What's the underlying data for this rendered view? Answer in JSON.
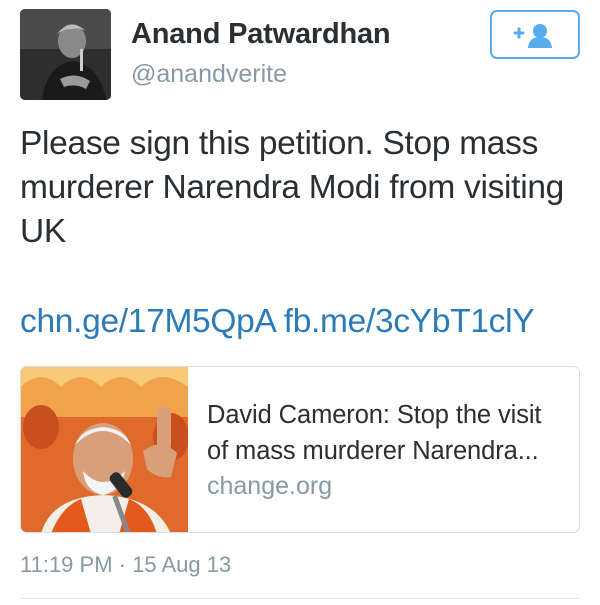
{
  "author": {
    "name": "Anand Patwardhan",
    "handle": "@anandverite"
  },
  "follow_button": {
    "label": "+",
    "icon": "person-add-icon"
  },
  "tweet": {
    "text": "Please sign this petition. Stop mass murderer Narendra Modi from visiting UK",
    "links": [
      "chn.ge/17M5QpA",
      "fb.me/3cYbT1clY"
    ]
  },
  "card": {
    "title": "David Cameron: Stop the visit of mass murderer Narendra...",
    "domain": "change.org"
  },
  "meta": {
    "time": "11:19 PM",
    "separator": "·",
    "date": "15 Aug 13"
  },
  "colors": {
    "accent": "#55acee",
    "link": "#2b7bb9",
    "muted": "#8899a6",
    "text": "#292f33"
  }
}
